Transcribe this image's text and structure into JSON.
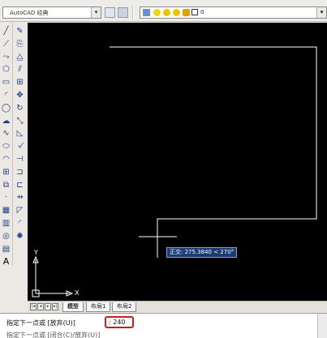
{
  "toolbar": {
    "workspace_value": "AutoCAD 经典",
    "layer_value": "0"
  },
  "left_tools": {
    "col1": [
      "line-icon",
      "construction-line-icon",
      "polyline-icon",
      "polygon-icon",
      "rectangle-icon",
      "arc-icon",
      "circle-icon",
      "revision-cloud-icon",
      "spline-icon",
      "ellipse-icon",
      "ellipse-arc-icon",
      "insert-block-icon",
      "make-block-icon",
      "point-icon",
      "hatch-icon",
      "gradient-icon",
      "region-icon",
      "table-icon",
      "multiline-text-icon"
    ],
    "col2": [
      "erase-icon",
      "copy-icon",
      "mirror-icon",
      "offset-icon",
      "array-icon",
      "move-icon",
      "rotate-icon",
      "scale-icon",
      "stretch-icon",
      "trim-icon",
      "extend-icon",
      "break-at-point-icon",
      "break-icon",
      "join-icon",
      "chamfer-icon",
      "fillet-icon",
      "explode-icon"
    ]
  },
  "canvas": {
    "tooltip": "正交: 275.3840 < 270°",
    "ucs_y": "Y",
    "ucs_x": "X"
  },
  "tabs": [
    {
      "label": "模型",
      "active": true
    },
    {
      "label": "布局1",
      "active": false
    },
    {
      "label": "布局2",
      "active": false
    }
  ],
  "command": {
    "line1_prompt": "指定下一点或 [放弃(U)]",
    "line1_value": ": 240",
    "line2_prompt": "指定下一点或 [闭合(C)/放弃(U)]"
  },
  "colors": {
    "canvas_bg": "#000000",
    "highlight_border": "#d31a1a",
    "tooltip_bg": "#1d3b73"
  }
}
